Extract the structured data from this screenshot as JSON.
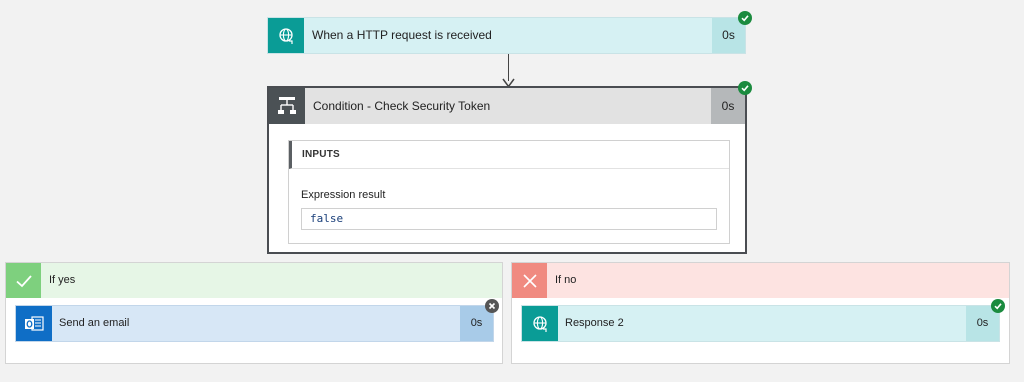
{
  "trigger": {
    "title": "When a HTTP request is received",
    "duration": "0s",
    "icon": "http-globe-icon",
    "status": "succeeded"
  },
  "condition": {
    "title": "Condition - Check Security Token",
    "duration": "0s",
    "icon": "condition-icon",
    "status": "succeeded",
    "inputs": {
      "header": "INPUTS",
      "expression_label": "Expression result",
      "expression_value": "false"
    }
  },
  "branches": {
    "yes": {
      "label": "If yes",
      "icon": "checkmark-icon",
      "action": {
        "title": "Send an email",
        "duration": "0s",
        "icon": "outlook-icon",
        "status": "skipped"
      }
    },
    "no": {
      "label": "If no",
      "icon": "x-icon",
      "action": {
        "title": "Response 2",
        "duration": "0s",
        "icon": "http-globe-icon",
        "status": "succeeded"
      }
    }
  },
  "colors": {
    "success": "#1b8b3f",
    "http_teal": "#0a9c96",
    "outlook_blue": "#0f6ec6",
    "yes_green": "#7ed07e",
    "no_red": "#f08a80"
  }
}
